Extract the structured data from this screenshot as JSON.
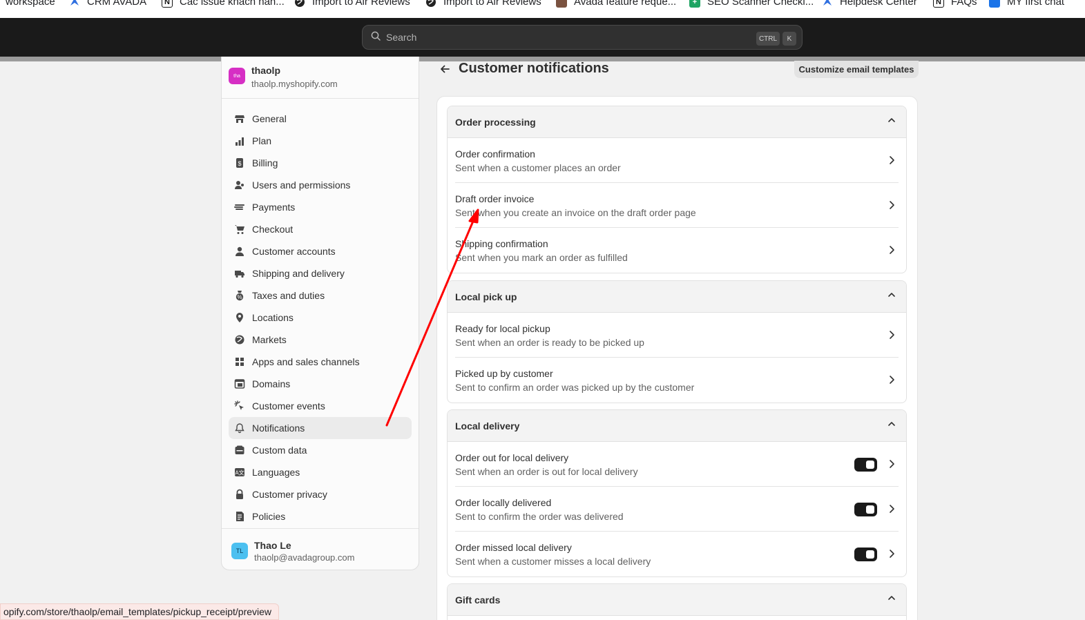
{
  "bookmarks": [
    {
      "label": "workspace",
      "icon": "none"
    },
    {
      "label": "CRM AVADA",
      "icon": "avada-icon"
    },
    {
      "label": "Các issue khách hàn...",
      "icon": "notion-icon"
    },
    {
      "label": "Import to Air Reviews",
      "icon": "globe-icon"
    },
    {
      "label": "Import to Air Reviews",
      "icon": "globe-icon"
    },
    {
      "label": "Avada feature reque...",
      "icon": "photo-icon"
    },
    {
      "label": "SEO Scanner Checkl...",
      "icon": "sheets-icon"
    },
    {
      "label": "Helpdesk Center",
      "icon": "avada-icon"
    },
    {
      "label": "FAQs",
      "icon": "notion-icon"
    },
    {
      "label": "MY first chat",
      "icon": "chat-icon"
    }
  ],
  "search": {
    "placeholder": "Search",
    "kbd_ctrl": "CTRL",
    "kbd_k": "K"
  },
  "store": {
    "avatar_text": "tha",
    "name": "thaolp",
    "url": "thaolp.myshopify.com"
  },
  "nav": [
    {
      "label": "General",
      "icon": "store-icon"
    },
    {
      "label": "Plan",
      "icon": "plan-icon"
    },
    {
      "label": "Billing",
      "icon": "billing-icon"
    },
    {
      "label": "Users and permissions",
      "icon": "users-icon"
    },
    {
      "label": "Payments",
      "icon": "payments-icon"
    },
    {
      "label": "Checkout",
      "icon": "cart-icon"
    },
    {
      "label": "Customer accounts",
      "icon": "person-icon"
    },
    {
      "label": "Shipping and delivery",
      "icon": "truck-icon"
    },
    {
      "label": "Taxes and duties",
      "icon": "tax-icon"
    },
    {
      "label": "Locations",
      "icon": "location-icon"
    },
    {
      "label": "Markets",
      "icon": "globe-icon"
    },
    {
      "label": "Apps and sales channels",
      "icon": "apps-icon"
    },
    {
      "label": "Domains",
      "icon": "domain-icon"
    },
    {
      "label": "Customer events",
      "icon": "cursor-icon"
    },
    {
      "label": "Notifications",
      "icon": "bell-icon",
      "active": true
    },
    {
      "label": "Custom data",
      "icon": "data-icon"
    },
    {
      "label": "Languages",
      "icon": "language-icon"
    },
    {
      "label": "Customer privacy",
      "icon": "lock-icon"
    },
    {
      "label": "Policies",
      "icon": "policy-icon"
    }
  ],
  "user": {
    "initials": "TL",
    "name": "Thao Le",
    "email": "thaolp@avadagroup.com"
  },
  "status_url": "opify.com/store/thaolp/email_templates/pickup_receipt/preview",
  "page": {
    "title": "Customer notifications",
    "customize_button": "Customize email templates"
  },
  "sections": [
    {
      "title": "Order processing",
      "rows": [
        {
          "title": "Order confirmation",
          "desc": "Sent when a customer places an order"
        },
        {
          "title": "Draft order invoice",
          "desc": "Sent when you create an invoice on the draft order page"
        },
        {
          "title": "Shipping confirmation",
          "desc": "Sent when you mark an order as fulfilled"
        }
      ]
    },
    {
      "title": "Local pick up",
      "rows": [
        {
          "title": "Ready for local pickup",
          "desc": "Sent when an order is ready to be picked up"
        },
        {
          "title": "Picked up by customer",
          "desc": "Sent to confirm an order was picked up by the customer"
        }
      ]
    },
    {
      "title": "Local delivery",
      "rows": [
        {
          "title": "Order out for local delivery",
          "desc": "Sent when an order is out for local delivery",
          "toggle": true
        },
        {
          "title": "Order locally delivered",
          "desc": "Sent to confirm the order was delivered",
          "toggle": true
        },
        {
          "title": "Order missed local delivery",
          "desc": "Sent when a customer misses a local delivery",
          "toggle": true
        }
      ]
    },
    {
      "title": "Gift cards",
      "rows": []
    }
  ],
  "colors": {
    "annotation_arrow": "#ff0000",
    "topbar": "#1a1a1a",
    "store_avatar": "#d62fc4",
    "user_avatar": "#4cc0f0"
  }
}
